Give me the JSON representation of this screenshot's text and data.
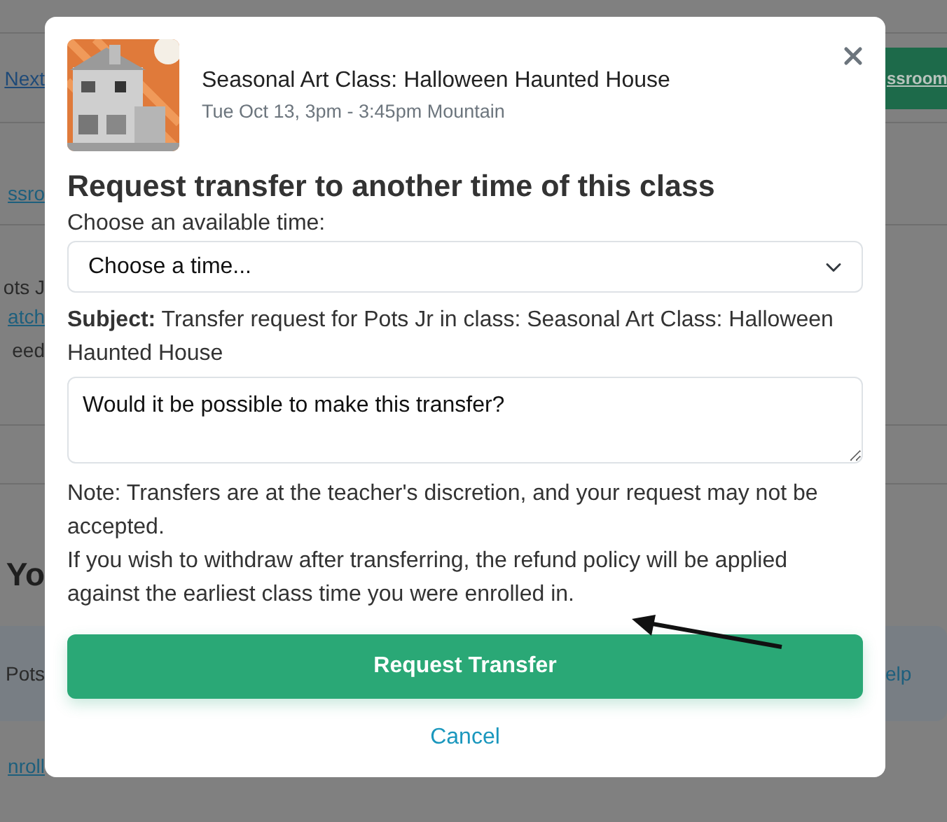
{
  "background": {
    "left_column": [
      {
        "kind": "link",
        "text": "Next"
      },
      {
        "kind": "link",
        "text": "ssro"
      },
      {
        "kind": "text",
        "text": "ots J"
      },
      {
        "kind": "link",
        "text": "atch"
      },
      {
        "kind": "text",
        "text": "eed"
      },
      {
        "kind": "heading",
        "text": "Yo"
      },
      {
        "kind": "panel",
        "text": "Pots"
      },
      {
        "kind": "link",
        "text": "nroll"
      }
    ],
    "right_column": [
      {
        "kind": "button",
        "text": "ssroom"
      },
      {
        "kind": "panel",
        "text": "elp"
      }
    ]
  },
  "modal": {
    "class_title": "Seasonal Art Class: Halloween Haunted House",
    "class_time": "Tue Oct 13, 3pm - 3:45pm Mountain",
    "heading": "Request transfer to another time of this class",
    "time_label": "Choose an available time:",
    "time_select": {
      "value": "Choose a time..."
    },
    "subject": "**Subject:** Transfer request for Pots Jr in class: Seasonal Art Class: Halloween Haunted House",
    "message": {
      "value": "Would it be possible to make this transfer?"
    },
    "notes": [
      "Note: Transfers are at the teacher's discretion, and your request may not be accepted.",
      "If you wish to withdraw after transferring, the refund policy will be applied against the earliest class time you were enrolled in."
    ],
    "annotation": {
      "kind": "arrow"
    },
    "submit_button": "Request Transfer",
    "cancel_link": "Cancel"
  }
}
